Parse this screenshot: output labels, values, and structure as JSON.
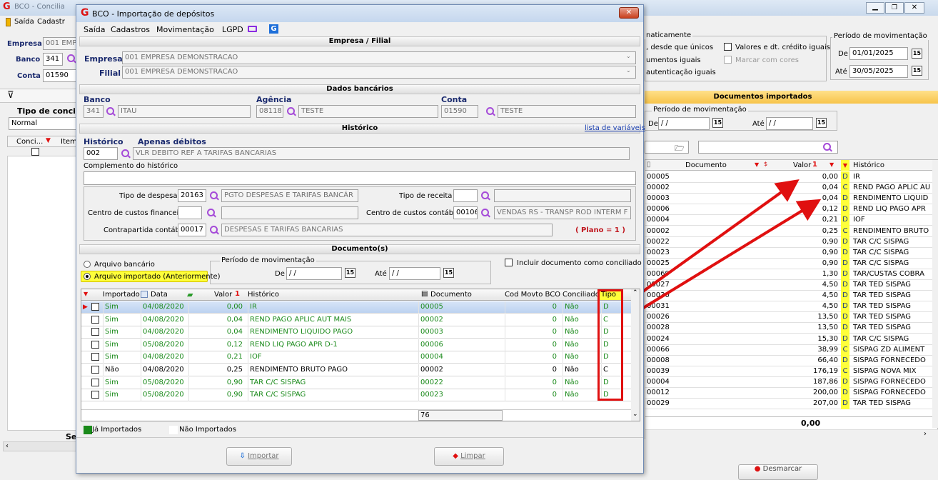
{
  "bg": {
    "title": "BCO - Concilia",
    "menu": [
      "Saída",
      "Cadastr"
    ],
    "empresa_label": "Empresa",
    "empresa_value": "001 EMP",
    "banco_label": "Banco",
    "banco_value": "341",
    "conta_label": "Conta",
    "conta_value": "01590",
    "tipo_label": "Tipo de concil",
    "tipo_value": "Normal",
    "col_conci": "Conci...",
    "col_item": "Item",
    "sel_label": "Sel"
  },
  "right": {
    "opt_auto": "naticamente",
    "opt_unicos": ", desde que únicos",
    "opt_docs": "umentos iguais",
    "opt_aut": "autenticação iguais",
    "opt_valores": "Valores e dt. crédito iguais",
    "opt_cores": "Marcar com cores",
    "periodo_title": "Período de movimentação",
    "de_label": "De",
    "de_value": "01/01/2025",
    "ate_label": "Até",
    "ate_value": "30/05/2025",
    "docs_title": "Documentos importados",
    "periodo2_title": "Período de movimentação",
    "de2_label": "De",
    "de2_value": "/ /",
    "ate2_label": "Até",
    "ate2_value": "/ /",
    "col_documento": "Documento",
    "col_valor": "Valor",
    "col_historico": "Histórico",
    "sort_mark": "1",
    "rows": [
      {
        "doc": "00005",
        "valor": "0,00",
        "tipo": "D",
        "hist": "IR"
      },
      {
        "doc": "00002",
        "valor": "0,04",
        "tipo": "C",
        "hist": "REND PAGO APLIC AU"
      },
      {
        "doc": "00003",
        "valor": "0,04",
        "tipo": "D",
        "hist": "RENDIMENTO LIQUID"
      },
      {
        "doc": "00006",
        "valor": "0,12",
        "tipo": "D",
        "hist": "REND LIQ PAGO APR"
      },
      {
        "doc": "00004",
        "valor": "0,21",
        "tipo": "D",
        "hist": "IOF"
      },
      {
        "doc": "00002",
        "valor": "0,25",
        "tipo": "C",
        "hist": "RENDIMENTO BRUTO"
      },
      {
        "doc": "00022",
        "valor": "0,90",
        "tipo": "D",
        "hist": "TAR C/C SISPAG"
      },
      {
        "doc": "00023",
        "valor": "0,90",
        "tipo": "D",
        "hist": "TAR C/C SISPAG"
      },
      {
        "doc": "00025",
        "valor": "0,90",
        "tipo": "D",
        "hist": "TAR C/C SISPAG"
      },
      {
        "doc": "00069",
        "valor": "1,30",
        "tipo": "D",
        "hist": "TAR/CUSTAS COBRA"
      },
      {
        "doc": "00027",
        "valor": "4,50",
        "tipo": "D",
        "hist": "TAR TED SISPAG"
      },
      {
        "doc": "00030",
        "valor": "4,50",
        "tipo": "D",
        "hist": "TAR TED SISPAG"
      },
      {
        "doc": "00031",
        "valor": "4,50",
        "tipo": "D",
        "hist": "TAR TED SISPAG"
      },
      {
        "doc": "00026",
        "valor": "13,50",
        "tipo": "D",
        "hist": "TAR TED SISPAG"
      },
      {
        "doc": "00028",
        "valor": "13,50",
        "tipo": "D",
        "hist": "TAR TED SISPAG"
      },
      {
        "doc": "00024",
        "valor": "15,30",
        "tipo": "D",
        "hist": "TAR C/C SISPAG"
      },
      {
        "doc": "00066",
        "valor": "38,99",
        "tipo": "C",
        "hist": "SISPAG ZD ALIMENT"
      },
      {
        "doc": "00008",
        "valor": "66,40",
        "tipo": "D",
        "hist": "SISPAG FORNECEDO"
      },
      {
        "doc": "00039",
        "valor": "176,19",
        "tipo": "C",
        "hist": "SISPAG NOVA MIX"
      },
      {
        "doc": "00004",
        "valor": "187,86",
        "tipo": "D",
        "hist": "SISPAG FORNECEDO"
      },
      {
        "doc": "00012",
        "valor": "200,00",
        "tipo": "D",
        "hist": "SISPAG FORNECEDO"
      },
      {
        "doc": "00029",
        "valor": "207,00",
        "tipo": "D",
        "hist": "TAR TED SISPAG"
      }
    ],
    "total": "0,00",
    "desmarcar": "Desmarcar"
  },
  "dialog": {
    "title": "BCO - Importação de depósitos",
    "menu": [
      "Saída",
      "Cadastros",
      "Movimentação",
      "LGPD"
    ],
    "sec_empresa": "Empresa / Filial",
    "empresa_label": "Empresa",
    "empresa_value": "001 EMPRESA DEMONSTRACAO",
    "filial_label": "Filial",
    "filial_value": "001 EMPRESA DEMONSTRACAO",
    "sec_banco": "Dados bancários",
    "banco_label": "Banco",
    "banco_code": "341",
    "banco_name": "ITAU",
    "agencia_label": "Agência",
    "agencia_code": "08118",
    "agencia_name": "TESTE",
    "conta_label": "Conta",
    "conta_code": "01590",
    "conta_name": "TESTE",
    "sec_hist": "Histórico",
    "lista_link": "lista de variáveis",
    "hist_label": "Histórico",
    "apenas_label": "Apenas débitos",
    "hist_code": "002",
    "hist_desc": "VLR DEBITO REF A TARIFAS BANCARIAS",
    "compl_label": "Complemento do histórico",
    "compl_value": "",
    "tipo_despesa_label": "Tipo de despesa",
    "tipo_despesa_code": "20163",
    "tipo_despesa_desc": "PGTO DESPESAS E TARIFAS BANCÁR",
    "tipo_receita_label": "Tipo de receita",
    "cc_fin_label": "Centro de custos financeiro",
    "cc_cont_label": "Centro de custos contábil",
    "cc_cont_code": "00106",
    "cc_cont_desc": "VENDAS RS - TRANSP ROD INTERM F",
    "contra_label": "Contrapartida contábil",
    "contra_code": "00017",
    "contra_desc": "DESPESAS E TARIFAS BANCARIAS",
    "plano": "( Plano = 1 )",
    "sec_docs": "Documento(s)",
    "radio_arquivo": "Arquivo bancário",
    "radio_importado": "Arquivo importado (Anteriormente)",
    "periodo_title": "Período de movimentação",
    "de_label": "De",
    "de_value": "/ /",
    "ate_label": "Até",
    "ate_value": "/ /",
    "incluir_label": "Incluir documento como conciliado",
    "columns": {
      "importado": "Importado",
      "data": "Data",
      "valor": "Valor",
      "historico": "Histórico",
      "documento": "Documento",
      "cod": "Cod Movto BCO",
      "conciliado": "Conciliado",
      "tipo": "Tipo"
    },
    "sort_mark": "1",
    "rows": [
      {
        "imp": "Sim",
        "data": "04/08/2020",
        "valor": "0,00",
        "hist": "IR",
        "doc": "00005",
        "cod": "0",
        "conc": "Não",
        "tipo": "D",
        "green": true,
        "sel": true
      },
      {
        "imp": "Sim",
        "data": "04/08/2020",
        "valor": "0,04",
        "hist": "REND PAGO APLIC AUT MAIS",
        "doc": "00002",
        "cod": "0",
        "conc": "Não",
        "tipo": "C",
        "green": true
      },
      {
        "imp": "Sim",
        "data": "04/08/2020",
        "valor": "0,04",
        "hist": "RENDIMENTO LIQUIDO PAGO",
        "doc": "00003",
        "cod": "0",
        "conc": "Não",
        "tipo": "D",
        "green": true
      },
      {
        "imp": "Sim",
        "data": "05/08/2020",
        "valor": "0,12",
        "hist": "REND LIQ PAGO APR D-1",
        "doc": "00006",
        "cod": "0",
        "conc": "Não",
        "tipo": "D",
        "green": true
      },
      {
        "imp": "Sim",
        "data": "04/08/2020",
        "valor": "0,21",
        "hist": "IOF",
        "doc": "00004",
        "cod": "0",
        "conc": "Não",
        "tipo": "D",
        "green": true
      },
      {
        "imp": "Não",
        "data": "04/08/2020",
        "valor": "0,25",
        "hist": "RENDIMENTO BRUTO PAGO",
        "doc": "00002",
        "cod": "0",
        "conc": "Não",
        "tipo": "C",
        "green": false
      },
      {
        "imp": "Sim",
        "data": "05/08/2020",
        "valor": "0,90",
        "hist": "TAR C/C SISPAG",
        "doc": "00022",
        "cod": "0",
        "conc": "Não",
        "tipo": "D",
        "green": true
      },
      {
        "imp": "Sim",
        "data": "05/08/2020",
        "valor": "0,90",
        "hist": "TAR C/C SISPAG",
        "doc": "00023",
        "cod": "0",
        "conc": "Não",
        "tipo": "D",
        "green": true
      }
    ],
    "count": "76",
    "legend_ja": "Já Importados",
    "legend_nao": "Não Importados",
    "btn_importar": "Importar",
    "btn_limpar": "Limpar"
  },
  "colors": {
    "green": "#1a8a1a",
    "highlight": "#ffff3a",
    "accent_red": "#e01010",
    "title_blue": "#1b3d7c"
  }
}
